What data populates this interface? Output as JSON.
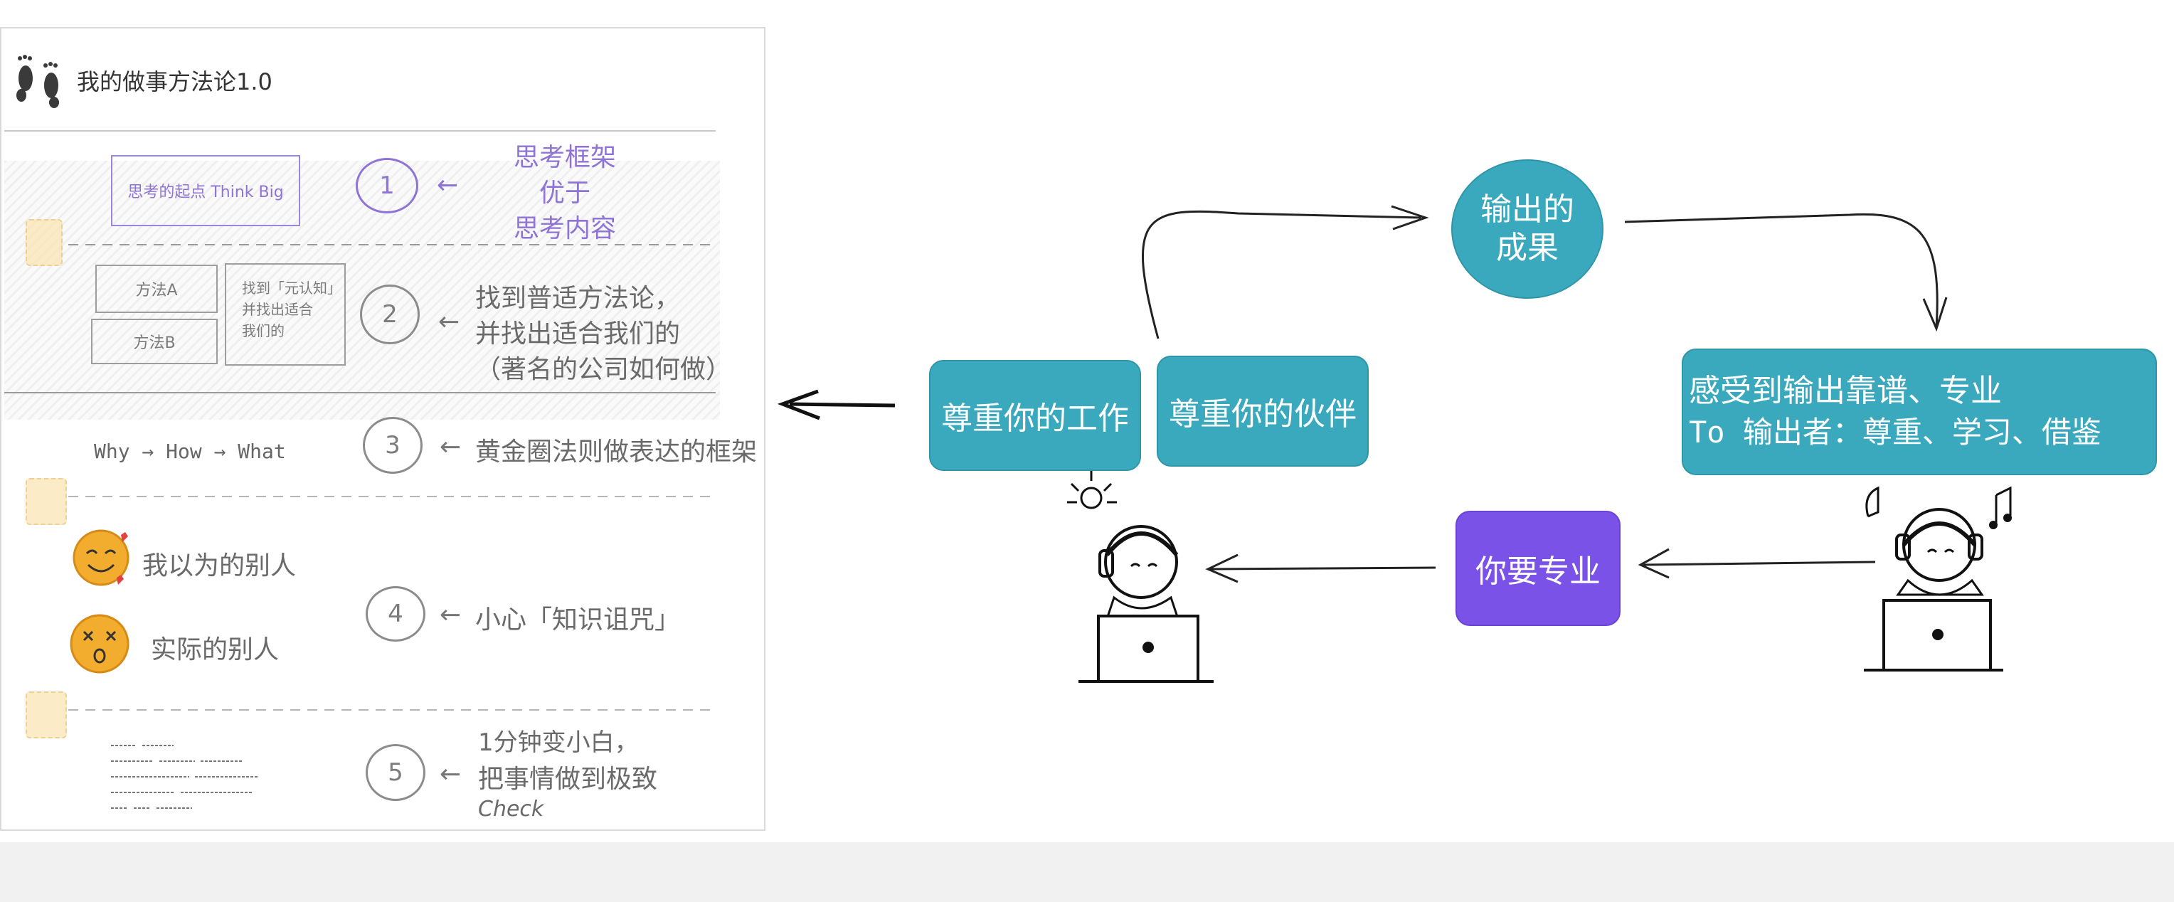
{
  "doc": {
    "title": "我的做事方法论1.0",
    "steps": [
      {
        "num": "1",
        "arrow": "←",
        "lines": [
          "思考框架",
          "优于",
          "思考内容"
        ]
      },
      {
        "num": "2",
        "arrow": "←",
        "lines": [
          "找到普适方法论，",
          "并找出适合我们的",
          "（著名的公司如何做）"
        ]
      },
      {
        "num": "3",
        "arrow": "←",
        "lines": [
          "黄金圈法则做表达的框架"
        ]
      },
      {
        "num": "4",
        "arrow": "←",
        "lines": [
          "小心「知识诅咒」"
        ]
      },
      {
        "num": "5",
        "arrow": "←",
        "lines": [
          "1分钟变小白，",
          "把事情做到极致",
          "Check"
        ]
      }
    ],
    "think_big": "思考的起点 Think Big",
    "method_a": "方法A",
    "method_b": "方法B",
    "find_box": [
      "找到「元认知」",
      "并找出适合",
      "我们的"
    ],
    "golden_circle": "Why → How → What",
    "others_imagined": "我以为的别人",
    "others_actual": "实际的别人"
  },
  "flow": {
    "respect_work": "尊重你的工作",
    "respect_partner": "尊重你的伙伴",
    "output_result": [
      "输出的",
      "成果"
    ],
    "feel": [
      "感受到输出靠谱、专业",
      "To 输出者：尊重、学习、借鉴"
    ],
    "be_pro": "你要专业",
    "colors": {
      "teal": "#3aa9bd",
      "purple": "#7b52e8"
    }
  }
}
